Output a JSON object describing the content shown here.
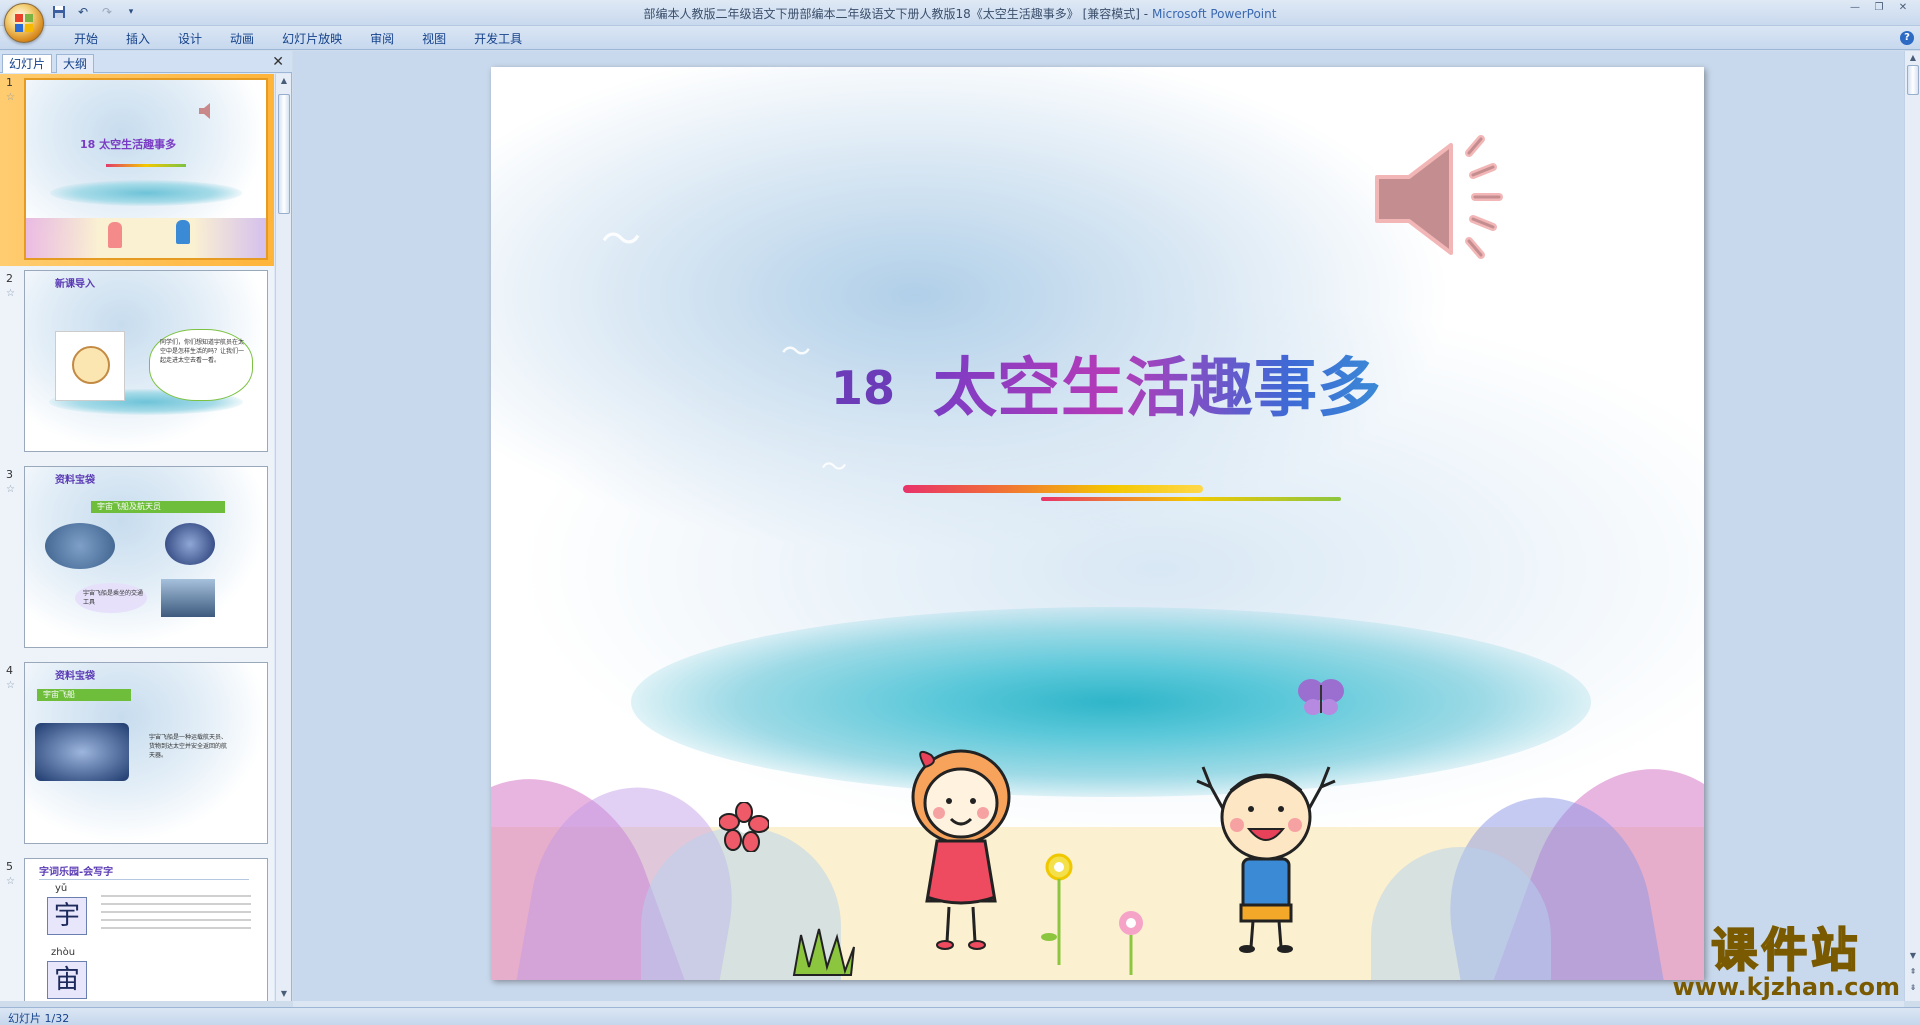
{
  "window": {
    "title_doc": "部编本人教版二年级语文下册部编本二年级语文下册人教版18《太空生活趣事多》 [兼容模式]",
    "title_sep": " - ",
    "title_app": "Microsoft PowerPoint"
  },
  "ribbon": {
    "tabs": [
      "开始",
      "插入",
      "设计",
      "动画",
      "幻灯片放映",
      "审阅",
      "视图",
      "开发工具"
    ]
  },
  "left_panel": {
    "tabs": [
      "幻灯片",
      "大纲"
    ],
    "slides": [
      {
        "number": "1",
        "title": "18  太空生活趣事多"
      },
      {
        "number": "2",
        "title": "新课导入",
        "text": "同学们，你们想知道宇航员在太空中是怎样生活的吗？让我们一起走进太空去看一看。"
      },
      {
        "number": "3",
        "title": "资料宝袋",
        "bar": "宇宙飞船及航天员",
        "caption": "宇宙飞船是乘坐的交通工具"
      },
      {
        "number": "4",
        "title": "资料宝袋",
        "bar": "宇宙飞船",
        "text": "宇宙飞船是一种运载航天员、货物到达太空并安全返回的航天器。"
      },
      {
        "number": "5",
        "title": "字词乐园-会写字",
        "chars": [
          {
            "pinyin": "yǔ",
            "char": "宇"
          },
          {
            "pinyin": "zhòu",
            "char": "宙"
          }
        ]
      }
    ]
  },
  "slide": {
    "number": "18",
    "title": "太空生活趣事多",
    "speaker_icon": "speaker-icon"
  },
  "status": {
    "slide_indicator": "幻灯片 1/32"
  },
  "watermark": {
    "brand": "课件站",
    "url": "www.kjzhan.com"
  }
}
